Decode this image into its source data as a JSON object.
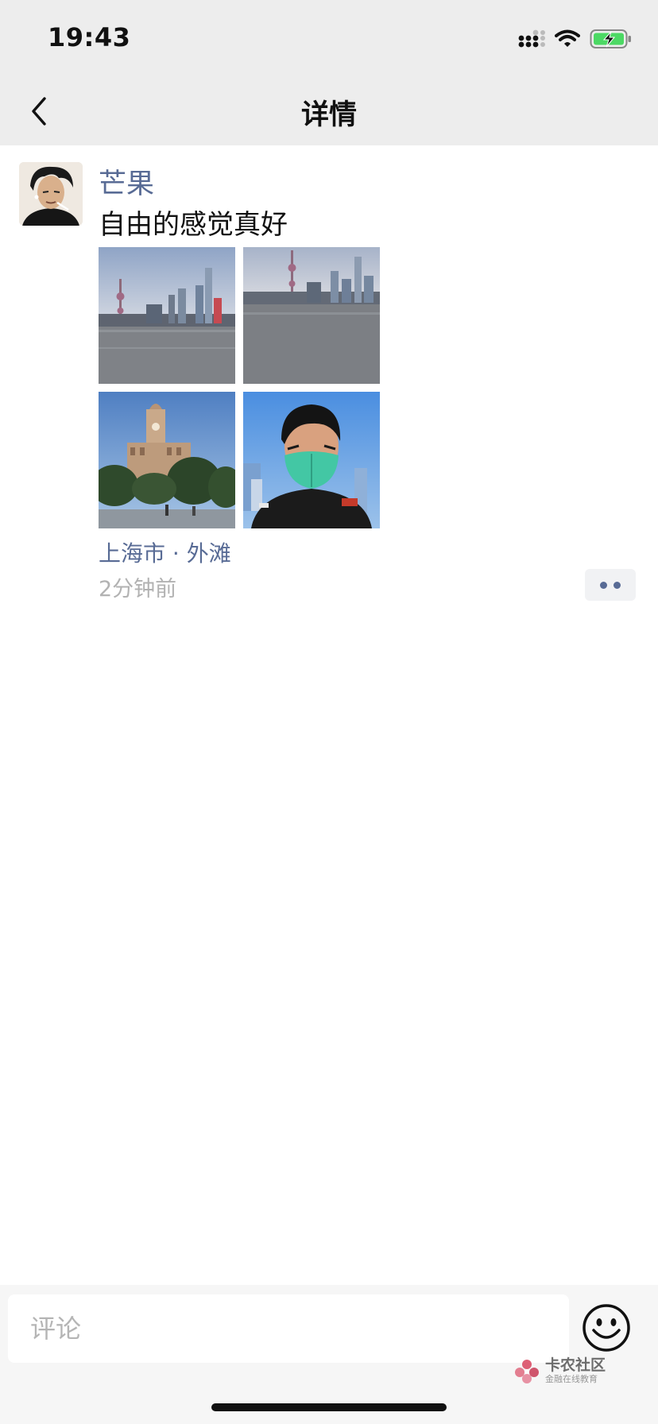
{
  "status_bar": {
    "time": "19:43"
  },
  "nav": {
    "title": "详情"
  },
  "post": {
    "author": "芒果",
    "content": "自由的感觉真好",
    "photos": [
      "skyline-photo",
      "skyline-photo",
      "customs-house-photo",
      "selfie-photo"
    ],
    "location": "上海市 · 外滩",
    "time": "2分钟前"
  },
  "comment_bar": {
    "placeholder": "评论"
  },
  "watermark": {
    "main": "卡农社区",
    "sub": "金融在线教育"
  },
  "colors": {
    "link": "#586b95",
    "nav_bg": "#ededed",
    "muted": "#b2b2b2"
  }
}
